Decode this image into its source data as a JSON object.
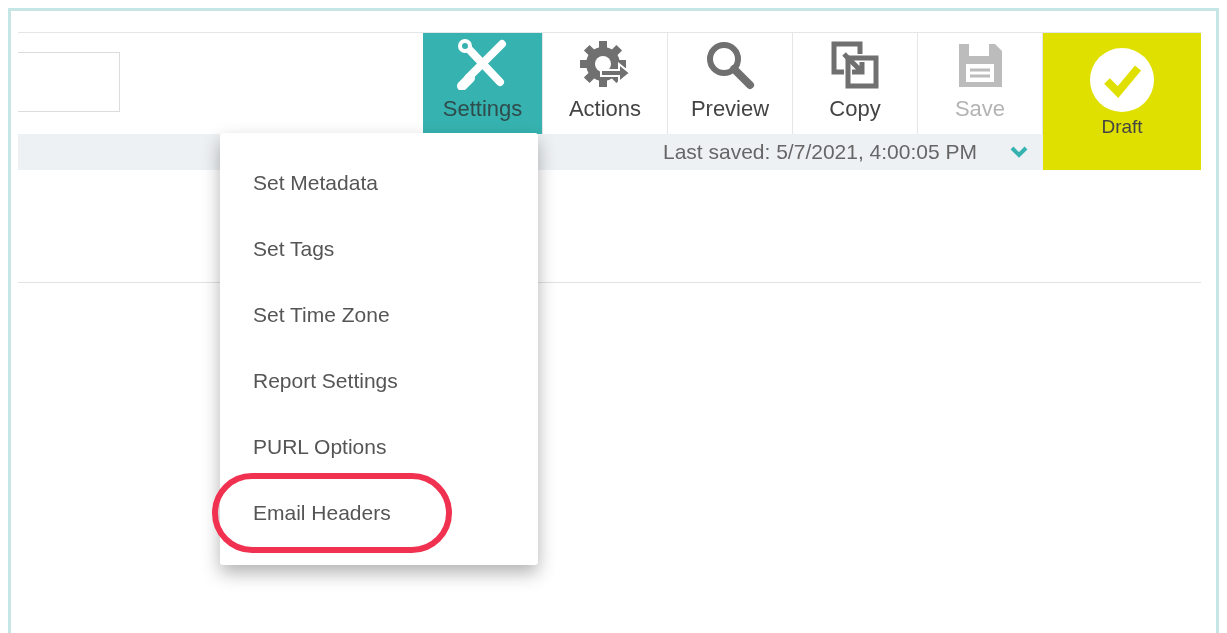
{
  "toolbar": {
    "buttons": [
      {
        "label": "Settings",
        "kind": "tools",
        "selected": true,
        "disabled": false
      },
      {
        "label": "Actions",
        "kind": "actions",
        "selected": false,
        "disabled": false
      },
      {
        "label": "Preview",
        "kind": "preview",
        "selected": false,
        "disabled": false
      },
      {
        "label": "Copy",
        "kind": "copy",
        "selected": false,
        "disabled": false
      },
      {
        "label": "Save",
        "kind": "save",
        "selected": false,
        "disabled": true
      }
    ],
    "status": {
      "label": "Draft"
    }
  },
  "status_bar": {
    "text": "Last saved: 5/7/2021, 4:00:05 PM",
    "expanded": false
  },
  "settings_menu": {
    "items": [
      {
        "label": "Set Metadata",
        "highlighted": false
      },
      {
        "label": "Set Tags",
        "highlighted": false
      },
      {
        "label": "Set Time Zone",
        "highlighted": false
      },
      {
        "label": "Report Settings",
        "highlighted": false
      },
      {
        "label": "PURL Options",
        "highlighted": false
      },
      {
        "label": "Email Headers",
        "highlighted": true
      }
    ]
  }
}
